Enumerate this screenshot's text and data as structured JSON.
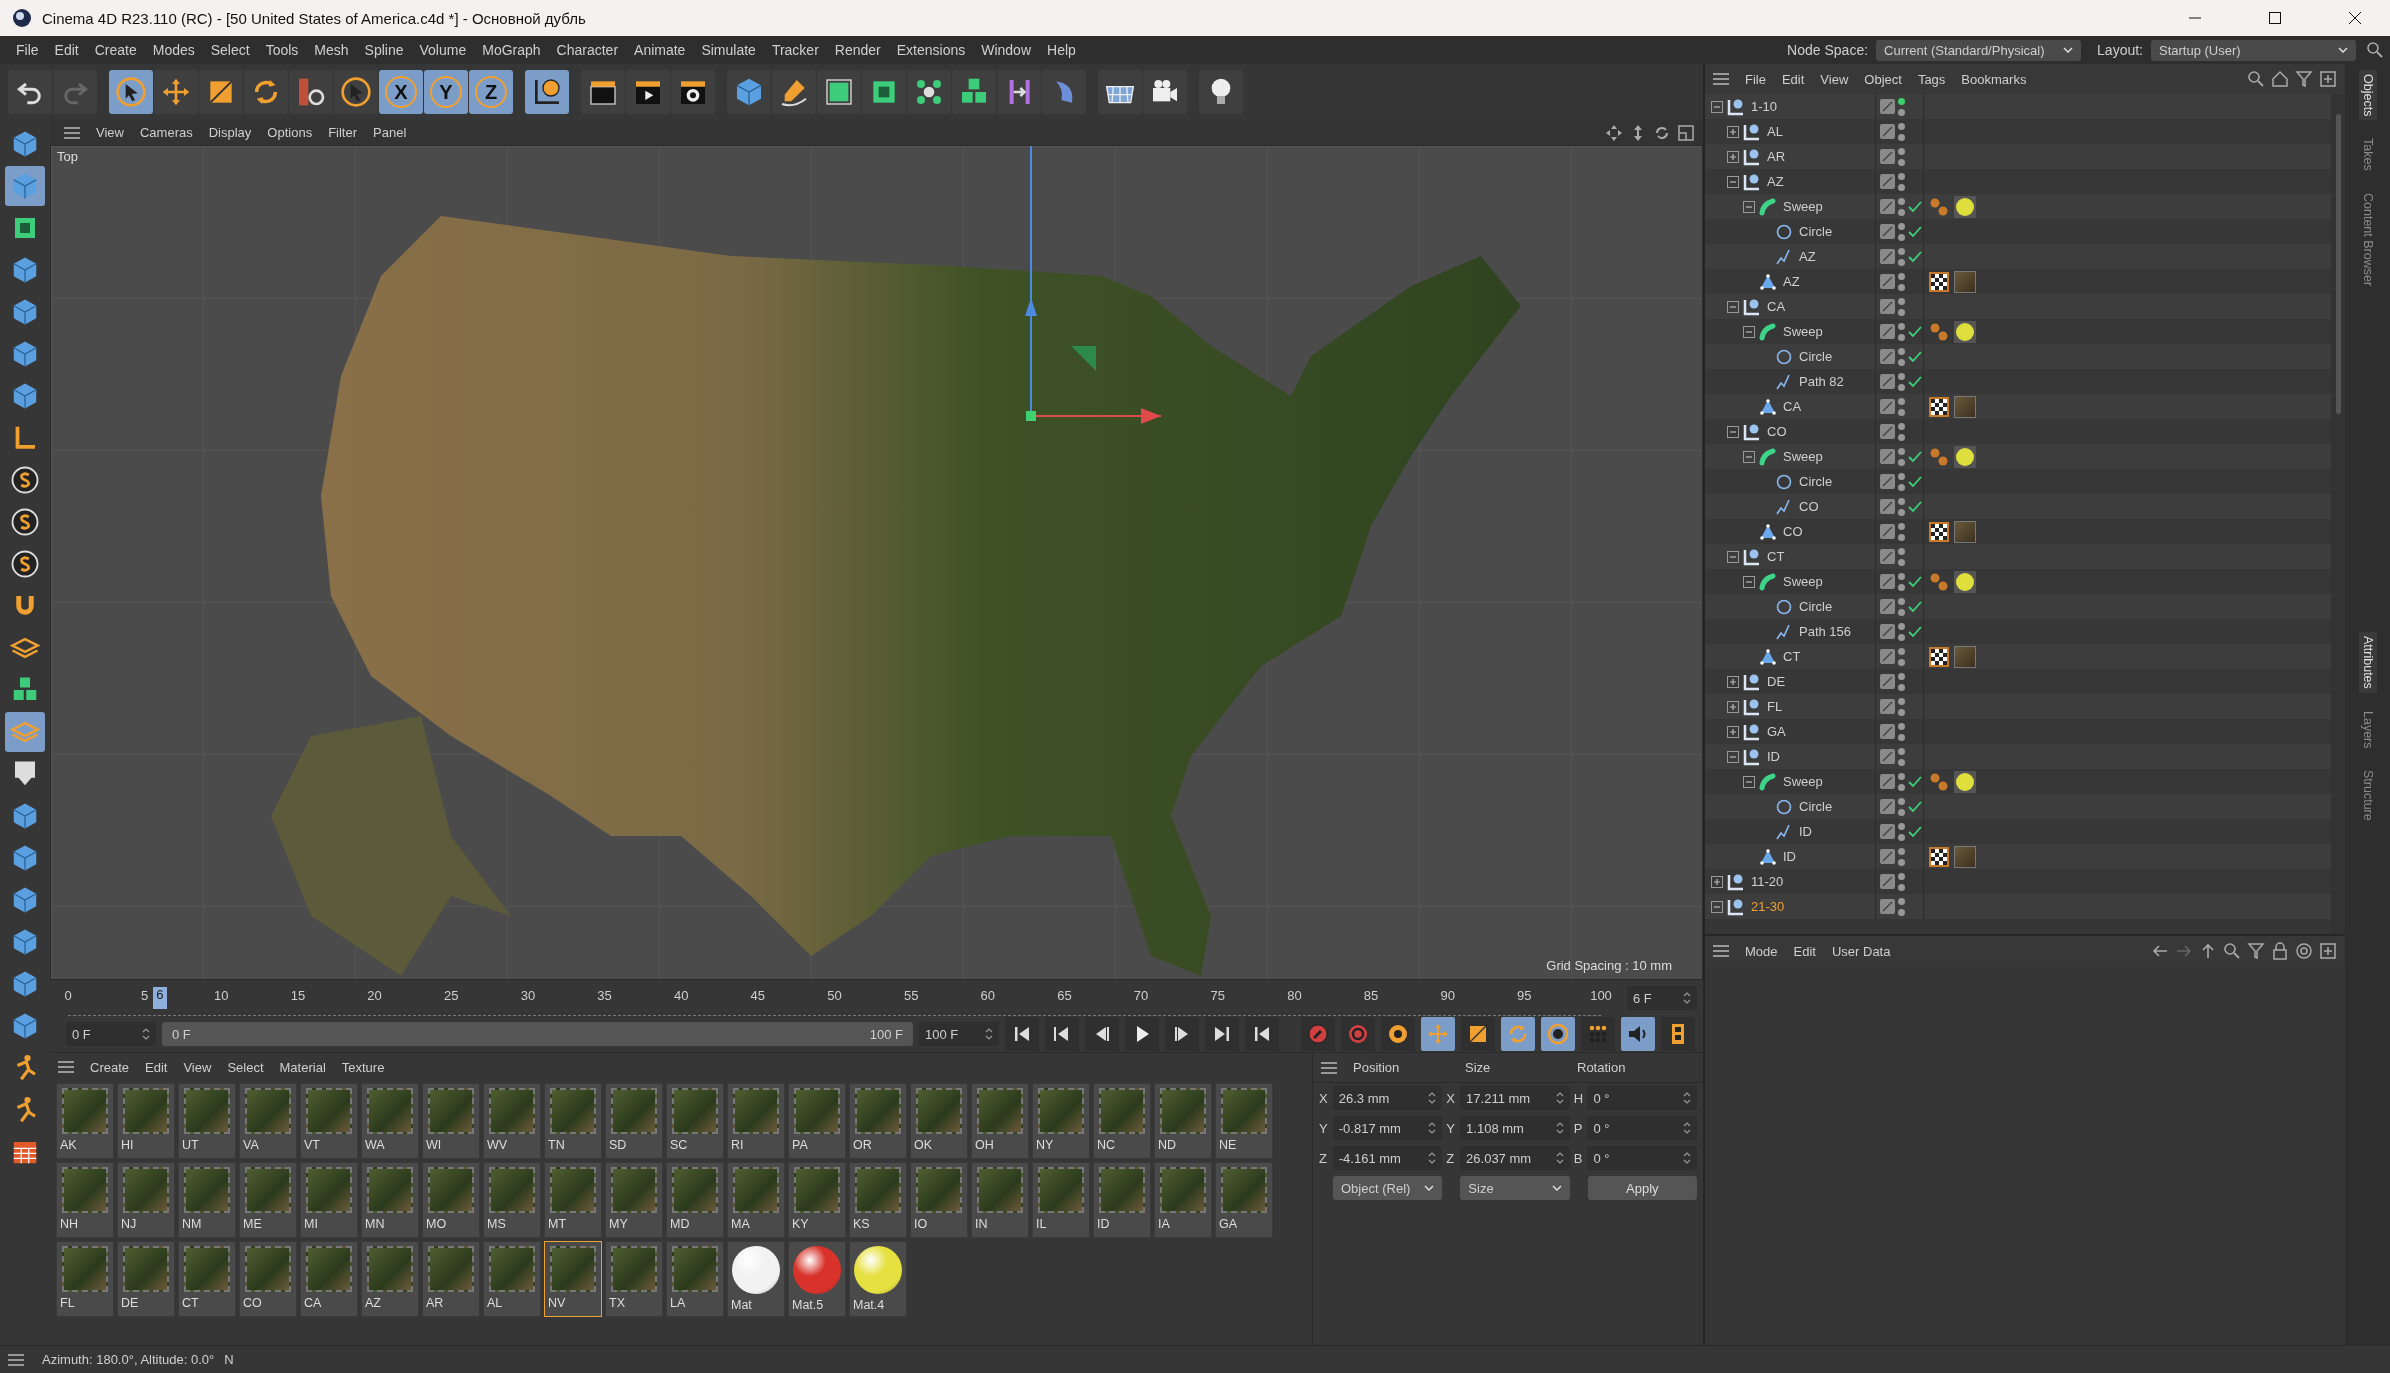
{
  "window": {
    "title": "Cinema 4D R23.110 (RC) - [50 United States of America.c4d *] - Основной дубль"
  },
  "menu": [
    "File",
    "Edit",
    "Create",
    "Modes",
    "Select",
    "Tools",
    "Mesh",
    "Spline",
    "Volume",
    "MoGraph",
    "Character",
    "Animate",
    "Simulate",
    "Tracker",
    "Render",
    "Extensions",
    "Window",
    "Help"
  ],
  "node_space": {
    "label": "Node Space:",
    "value": "Current (Standard/Physical)"
  },
  "layout": {
    "label": "Layout:",
    "value": "Startup (User)"
  },
  "toolbar": {
    "tools": [
      {
        "on": false
      },
      {
        "on": false
      },
      {
        "on": true
      },
      {
        "on": false
      },
      {
        "on": false
      },
      {
        "on": false
      },
      {
        "on": false
      },
      {
        "on": false
      },
      {
        "on": true
      },
      {
        "on": false
      },
      {
        "on": false
      },
      {
        "on": false
      },
      {
        "on": false
      },
      {
        "on": false
      },
      {
        "on": false
      },
      {
        "on": false
      },
      {
        "on": false
      },
      {
        "on": false
      },
      {
        "on": false
      },
      {
        "on": false
      },
      {
        "on": false
      },
      {
        "on": false
      },
      {
        "on": false
      }
    ],
    "axis_buttons": [
      {
        "label": "X",
        "on": true
      },
      {
        "label": "Y",
        "on": true
      },
      {
        "label": "Z",
        "on": true
      }
    ]
  },
  "left_tools": [
    {
      "on": false
    },
    {
      "on": true
    },
    {
      "on": false
    },
    {
      "on": false
    },
    {
      "on": false
    },
    {
      "on": false
    },
    {
      "on": false
    },
    {
      "on": false
    },
    {
      "on": false
    },
    {
      "on": false
    },
    {
      "on": false
    },
    {
      "on": false
    },
    {
      "on": false
    },
    {
      "on": false
    },
    {
      "on": true
    },
    {
      "on": false
    },
    {
      "on": false
    },
    {
      "on": false
    },
    {
      "on": false
    },
    {
      "on": false
    },
    {
      "on": false
    },
    {
      "on": false
    },
    {
      "on": false
    },
    {
      "on": false
    },
    {
      "on": false
    }
  ],
  "viewport": {
    "menu": [
      "View",
      "Cameras",
      "Display",
      "Options",
      "Filter",
      "Panel"
    ],
    "label": "Top",
    "grid_spacing": "Grid Spacing : 10 mm"
  },
  "timeline": {
    "ticks": [
      "0",
      "5",
      "10",
      "15",
      "20",
      "25",
      "30",
      "35",
      "40",
      "45",
      "50",
      "55",
      "60",
      "65",
      "70",
      "75",
      "80",
      "85",
      "90",
      "95",
      "100"
    ],
    "current": "6",
    "level": 0.06,
    "current_field": "6 F",
    "start_field": "0 F",
    "range": {
      "start": "0 F",
      "end": "100 F",
      "level": 1
    },
    "end_field": "100 F",
    "key_tools": [
      {
        "on": false
      },
      {
        "on": false
      },
      {
        "on": false
      },
      {
        "on": true
      },
      {
        "on": false
      },
      {
        "on": true
      },
      {
        "on": true
      },
      {
        "on": false
      },
      {
        "on": true
      },
      {
        "on": false
      }
    ]
  },
  "materials": {
    "menu": [
      "Create",
      "Edit",
      "View",
      "Select",
      "Material",
      "Texture"
    ],
    "items": [
      {
        "name": "AK",
        "kind": "texture",
        "selected": false
      },
      {
        "name": "HI",
        "kind": "texture",
        "selected": false
      },
      {
        "name": "UT",
        "kind": "texture",
        "selected": false
      },
      {
        "name": "VA",
        "kind": "texture",
        "selected": false
      },
      {
        "name": "VT",
        "kind": "texture",
        "selected": false
      },
      {
        "name": "WA",
        "kind": "texture",
        "selected": false
      },
      {
        "name": "WI",
        "kind": "texture",
        "selected": false
      },
      {
        "name": "WV",
        "kind": "texture",
        "selected": false
      },
      {
        "name": "TN",
        "kind": "texture",
        "selected": false
      },
      {
        "name": "SD",
        "kind": "texture",
        "selected": false
      },
      {
        "name": "SC",
        "kind": "texture",
        "selected": false
      },
      {
        "name": "RI",
        "kind": "texture",
        "selected": false
      },
      {
        "name": "PA",
        "kind": "texture",
        "selected": false
      },
      {
        "name": "OR",
        "kind": "texture",
        "selected": false
      },
      {
        "name": "OK",
        "kind": "texture",
        "selected": false
      },
      {
        "name": "OH",
        "kind": "texture",
        "selected": false
      },
      {
        "name": "NY",
        "kind": "texture",
        "selected": false
      },
      {
        "name": "NC",
        "kind": "texture",
        "selected": false
      },
      {
        "name": "ND",
        "kind": "texture",
        "selected": false
      },
      {
        "name": "NE",
        "kind": "texture",
        "selected": false
      },
      {
        "name": "NH",
        "kind": "texture",
        "selected": false
      },
      {
        "name": "NJ",
        "kind": "texture",
        "selected": false
      },
      {
        "name": "NM",
        "kind": "texture",
        "selected": false
      },
      {
        "name": "ME",
        "kind": "texture",
        "selected": false
      },
      {
        "name": "MI",
        "kind": "texture",
        "selected": false
      },
      {
        "name": "MN",
        "kind": "texture",
        "selected": false
      },
      {
        "name": "MO",
        "kind": "texture",
        "selected": false
      },
      {
        "name": "MS",
        "kind": "texture",
        "selected": false
      },
      {
        "name": "MT",
        "kind": "texture",
        "selected": false
      },
      {
        "name": "MY",
        "kind": "texture",
        "selected": false
      },
      {
        "name": "MD",
        "kind": "texture",
        "selected": false
      },
      {
        "name": "MA",
        "kind": "texture",
        "selected": false
      },
      {
        "name": "KY",
        "kind": "texture",
        "selected": false
      },
      {
        "name": "KS",
        "kind": "texture",
        "selected": false
      },
      {
        "name": "IO",
        "kind": "texture",
        "selected": false
      },
      {
        "name": "IN",
        "kind": "texture",
        "selected": false
      },
      {
        "name": "IL",
        "kind": "texture",
        "selected": false
      },
      {
        "name": "ID",
        "kind": "texture",
        "selected": false
      },
      {
        "name": "IA",
        "kind": "texture",
        "selected": false
      },
      {
        "name": "GA",
        "kind": "texture",
        "selected": false
      },
      {
        "name": "FL",
        "kind": "texture",
        "selected": false
      },
      {
        "name": "DE",
        "kind": "texture",
        "selected": false
      },
      {
        "name": "CT",
        "kind": "texture",
        "selected": false
      },
      {
        "name": "CO",
        "kind": "texture",
        "selected": false
      },
      {
        "name": "CA",
        "kind": "texture",
        "selected": false
      },
      {
        "name": "AZ",
        "kind": "texture",
        "selected": false
      },
      {
        "name": "AR",
        "kind": "texture",
        "selected": false
      },
      {
        "name": "AL",
        "kind": "texture",
        "selected": false
      },
      {
        "name": "NV",
        "kind": "texture",
        "selected": true
      },
      {
        "name": "TX",
        "kind": "texture",
        "selected": false
      },
      {
        "name": "LA",
        "kind": "texture",
        "selected": false
      },
      {
        "name": "Mat",
        "kind": "sphere",
        "color": "#f2f2f2",
        "selected": false
      },
      {
        "name": "Mat.5",
        "kind": "sphere",
        "color": "#d8322a",
        "selected": false
      },
      {
        "name": "Mat.4",
        "kind": "sphere",
        "color": "#e6e040",
        "selected": false
      }
    ]
  },
  "coordinates": {
    "headers": [
      "Position",
      "Size",
      "Rotation"
    ],
    "rows": [
      {
        "axis": "X",
        "position": "26.3 mm",
        "size_axis": "X",
        "size": "17.211 mm",
        "rotation_axis": "H",
        "rotation": "0 °"
      },
      {
        "axis": "Y",
        "position": "-0.817 mm",
        "size_axis": "Y",
        "size": "1.108 mm",
        "rotation_axis": "P",
        "rotation": "0 °"
      },
      {
        "axis": "Z",
        "position": "-4.161 mm",
        "size_axis": "Z",
        "size": "26.037 mm",
        "rotation_axis": "B",
        "rotation": "0 °"
      }
    ],
    "mode": "Object (Rel)",
    "size_mode": "Size",
    "apply": "Apply"
  },
  "objects": {
    "menu": [
      "File",
      "Edit",
      "View",
      "Object",
      "Tags",
      "Bookmarks"
    ],
    "tree": [
      {
        "name": "1-10",
        "kind": "null",
        "expanded": true,
        "dot_active": true,
        "selected": false,
        "children": [
          {
            "name": "AL",
            "kind": "null",
            "expanded": false,
            "dot_active": false,
            "selected": false
          },
          {
            "name": "AR",
            "kind": "null",
            "expanded": false,
            "dot_active": false,
            "selected": false
          },
          {
            "name": "AZ",
            "kind": "null",
            "expanded": true,
            "dot_active": false,
            "selected": false,
            "children": [
              {
                "name": "Sweep",
                "kind": "sweep",
                "expanded": true,
                "dot_active": false,
                "selected": false,
                "enabled": true,
                "tags": [
                  {
                    "kind": "phong"
                  },
                  {
                    "kind": "material"
                  }
                ],
                "children": [
                  {
                    "name": "Circle",
                    "kind": "circle",
                    "dot_active": false,
                    "selected": false,
                    "enabled": true
                  },
                  {
                    "name": "AZ",
                    "kind": "spline",
                    "dot_active": false,
                    "selected": false,
                    "enabled": true
                  }
                ]
              },
              {
                "name": "AZ",
                "kind": "polygon",
                "dot_active": false,
                "selected": false,
                "tags": [
                  {
                    "kind": "checker"
                  },
                  {
                    "kind": "texture"
                  }
                ]
              }
            ]
          },
          {
            "name": "CA",
            "kind": "null",
            "expanded": true,
            "dot_active": false,
            "selected": false,
            "children": [
              {
                "name": "Sweep",
                "kind": "sweep",
                "expanded": true,
                "dot_active": false,
                "selected": false,
                "enabled": true,
                "tags": [
                  {
                    "kind": "phong"
                  },
                  {
                    "kind": "material"
                  }
                ],
                "children": [
                  {
                    "name": "Circle",
                    "kind": "circle",
                    "dot_active": false,
                    "selected": false,
                    "enabled": true
                  },
                  {
                    "name": "Path 82",
                    "kind": "spline",
                    "dot_active": false,
                    "selected": false,
                    "enabled": true
                  }
                ]
              },
              {
                "name": "CA",
                "kind": "polygon",
                "dot_active": false,
                "selected": false,
                "tags": [
                  {
                    "kind": "checker"
                  },
                  {
                    "kind": "texture"
                  }
                ]
              }
            ]
          },
          {
            "name": "CO",
            "kind": "null",
            "expanded": true,
            "dot_active": false,
            "selected": false,
            "children": [
              {
                "name": "Sweep",
                "kind": "sweep",
                "expanded": true,
                "dot_active": false,
                "selected": false,
                "enabled": true,
                "tags": [
                  {
                    "kind": "phong"
                  },
                  {
                    "kind": "material"
                  }
                ],
                "children": [
                  {
                    "name": "Circle",
                    "kind": "circle",
                    "dot_active": false,
                    "selected": false,
                    "enabled": true
                  },
                  {
                    "name": "CO",
                    "kind": "spline",
                    "dot_active": false,
                    "selected": false,
                    "enabled": true
                  }
                ]
              },
              {
                "name": "CO",
                "kind": "polygon",
                "dot_active": false,
                "selected": false,
                "tags": [
                  {
                    "kind": "checker"
                  },
                  {
                    "kind": "texture"
                  }
                ]
              }
            ]
          },
          {
            "name": "CT",
            "kind": "null",
            "expanded": true,
            "dot_active": false,
            "selected": false,
            "children": [
              {
                "name": "Sweep",
                "kind": "sweep",
                "expanded": true,
                "dot_active": false,
                "selected": false,
                "enabled": true,
                "tags": [
                  {
                    "kind": "phong"
                  },
                  {
                    "kind": "material"
                  }
                ],
                "children": [
                  {
                    "name": "Circle",
                    "kind": "circle",
                    "dot_active": false,
                    "selected": false,
                    "enabled": true
                  },
                  {
                    "name": "Path 156",
                    "kind": "spline",
                    "dot_active": false,
                    "selected": false,
                    "enabled": true
                  }
                ]
              },
              {
                "name": "CT",
                "kind": "polygon",
                "dot_active": false,
                "selected": false,
                "tags": [
                  {
                    "kind": "checker"
                  },
                  {
                    "kind": "texture"
                  }
                ]
              }
            ]
          },
          {
            "name": "DE",
            "kind": "null",
            "expanded": false,
            "dot_active": false,
            "selected": false
          },
          {
            "name": "FL",
            "kind": "null",
            "expanded": false,
            "dot_active": false,
            "selected": false
          },
          {
            "name": "GA",
            "kind": "null",
            "expanded": false,
            "dot_active": false,
            "selected": false
          },
          {
            "name": "ID",
            "kind": "null",
            "expanded": true,
            "dot_active": false,
            "selected": false,
            "children": [
              {
                "name": "Sweep",
                "kind": "sweep",
                "expanded": true,
                "dot_active": false,
                "selected": false,
                "enabled": true,
                "tags": [
                  {
                    "kind": "phong"
                  },
                  {
                    "kind": "material"
                  }
                ],
                "children": [
                  {
                    "name": "Circle",
                    "kind": "circle",
                    "dot_active": false,
                    "selected": false,
                    "enabled": true
                  },
                  {
                    "name": "ID",
                    "kind": "spline",
                    "dot_active": false,
                    "selected": false,
                    "enabled": true
                  }
                ]
              },
              {
                "name": "ID",
                "kind": "polygon",
                "dot_active": false,
                "selected": false,
                "tags": [
                  {
                    "kind": "checker"
                  },
                  {
                    "kind": "texture"
                  }
                ]
              }
            ]
          }
        ]
      },
      {
        "name": "11-20",
        "kind": "null",
        "expanded": false,
        "dot_active": false,
        "selected": false
      },
      {
        "name": "21-30",
        "kind": "null",
        "expanded": true,
        "dot_active": false,
        "selected": true
      }
    ]
  },
  "attributes": {
    "menu": [
      "Mode",
      "Edit",
      "User Data"
    ]
  },
  "side_tabs_top": [
    {
      "label": "Objects",
      "selected": true
    },
    {
      "label": "Takes",
      "selected": false
    },
    {
      "label": "Content Browser",
      "selected": false
    }
  ],
  "side_tabs_bottom": [
    {
      "label": "Attributes",
      "selected": true
    },
    {
      "label": "Layers",
      "selected": false
    },
    {
      "label": "Structure",
      "selected": false
    }
  ],
  "status_bar": {
    "text": "Azimuth: 180.0°, Altitude: 0.0°",
    "direction": "N"
  }
}
